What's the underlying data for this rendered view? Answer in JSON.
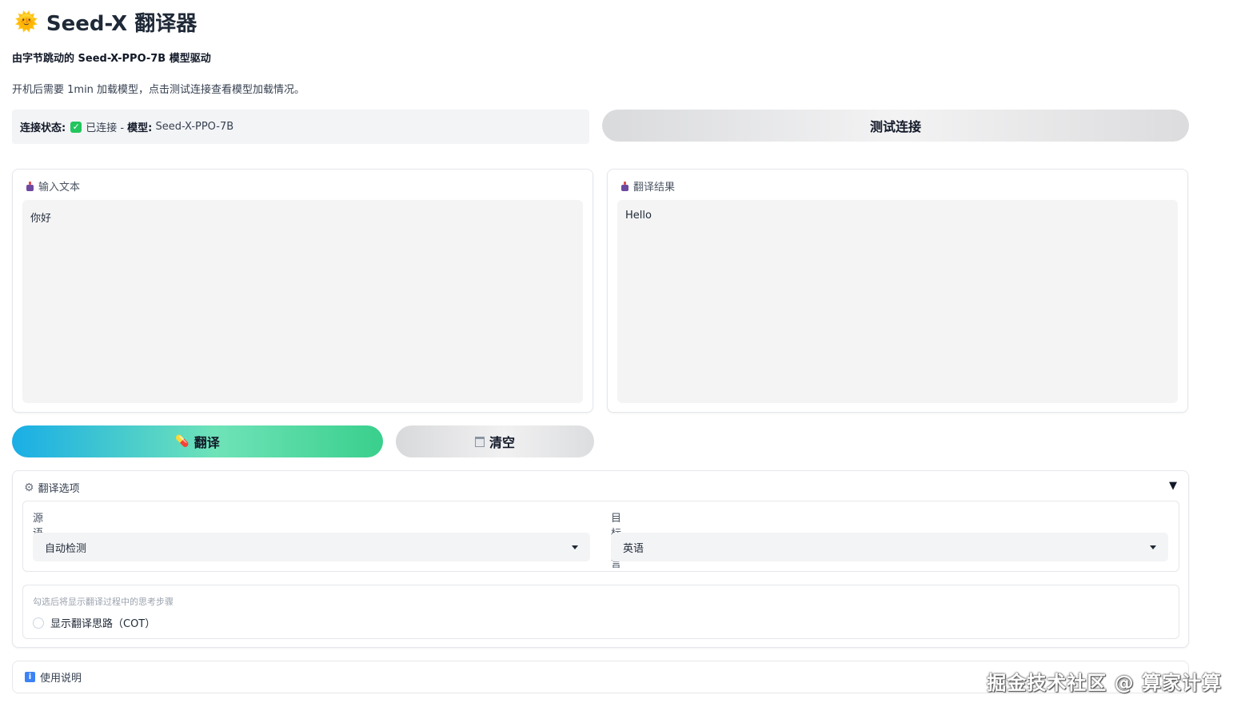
{
  "header": {
    "icon": "sun-icon",
    "title": "Seed-X 翻译器",
    "subtitle": "由字节跳动的 Seed-X-PPO-7B 模型驱动",
    "note": "开机后需要 1min 加载模型，点击测试连接查看模型加载情况。"
  },
  "status": {
    "label": "连接状态:",
    "connected": "已连接 -",
    "model_label": "模型:",
    "model_value": "Seed-X-PPO-7B",
    "test_button": "测试连接"
  },
  "input": {
    "label": "输入文本",
    "value": "你好"
  },
  "output": {
    "label": "翻译结果",
    "value": "Hello"
  },
  "actions": {
    "translate": "翻译",
    "clear": "清空"
  },
  "options": {
    "title": "翻译选项",
    "source_label": "源语言",
    "source_value": "自动检测",
    "target_label": "目标语言",
    "target_value": "英语",
    "cot_hint": "勾选后将显示翻译过程中的思考步骤",
    "cot_label": "显示翻译思路（COT）"
  },
  "usage": {
    "label": "使用说明"
  },
  "watermark": "掘金技术社区 @ 算家计算"
}
